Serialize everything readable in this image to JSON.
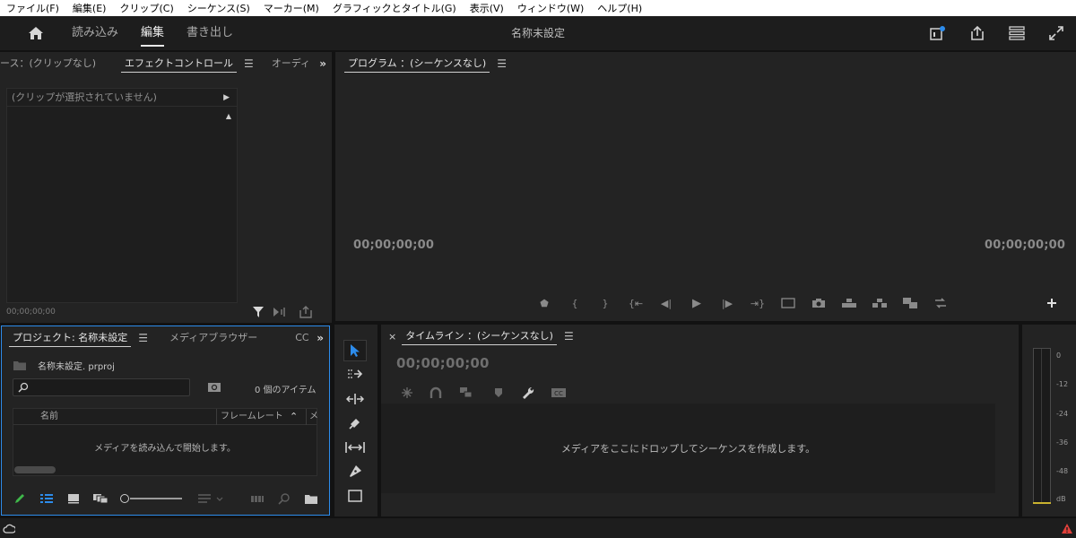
{
  "menu": [
    "ファイル(F)",
    "編集(E)",
    "クリップ(C)",
    "シーケンス(S)",
    "マーカー(M)",
    "グラフィックとタイトル(G)",
    "表示(V)",
    "ウィンドウ(W)",
    "ヘルプ(H)"
  ],
  "header": {
    "tabs": [
      "読み込み",
      "編集",
      "書き出し"
    ],
    "active_tab": "編集",
    "title": "名称未設定",
    "icons": [
      "notification-icon",
      "share-icon",
      "workspaces-icon",
      "fullscreen-icon"
    ],
    "accent_color": "#2d8ceb"
  },
  "source_panel": {
    "tabs": [
      "ース：(クリップなし)",
      "エフェクトコントロール",
      "オーディ"
    ],
    "active_tab": "エフェクトコントロール",
    "no_clip_text": "(クリップが選択されていません)",
    "timecode": "00;00;00;00"
  },
  "program_panel": {
    "title": "プログラム ：(シーケンスなし)",
    "timecode_left": "00;00;00;00",
    "timecode_right": "00;00;00;00"
  },
  "project_panel": {
    "tabs": [
      "プロジェクト: 名称未設定",
      "メディアブラウザー",
      "CC"
    ],
    "active_tab": "プロジェクト: 名称未設定",
    "file_name": "名称未設定. prproj",
    "search_value": "",
    "items_count": "0 個のアイテム",
    "columns": [
      "名前",
      "フレームレート",
      "メ"
    ],
    "empty_message": "メディアを読み込んで開始します。"
  },
  "timeline_panel": {
    "title": "タイムライン ：(シーケンスなし)",
    "close_glyph": "×",
    "timecode": "00;00;00;00",
    "drop_message": "メディアをここにドロップしてシーケンスを作成します。"
  },
  "audio_meter": {
    "scale": [
      "0",
      "-12",
      "-24",
      "-36",
      "-48",
      "dB"
    ]
  }
}
